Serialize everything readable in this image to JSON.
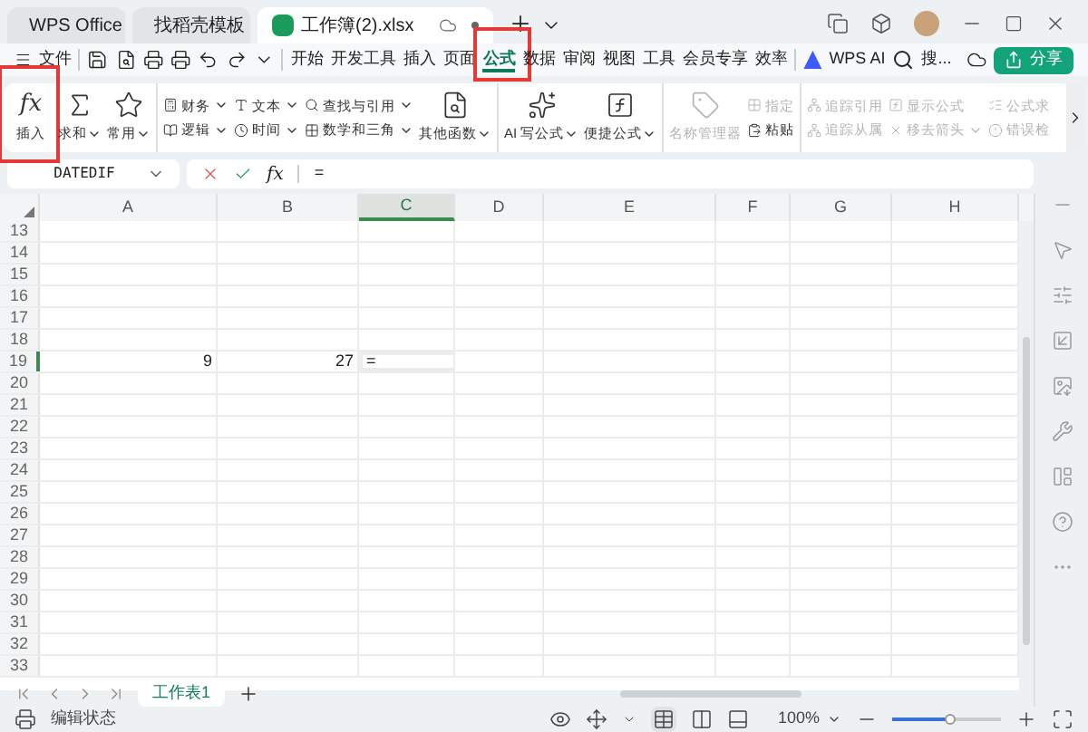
{
  "title_bar": {
    "tabs": [
      {
        "label": "WPS Office",
        "kind": "home",
        "selected": false
      },
      {
        "label": "找稻壳模板",
        "kind": "template",
        "selected": false
      },
      {
        "label": "工作簿(2).xlsx",
        "kind": "sheet",
        "selected": true
      }
    ]
  },
  "menu_bar": {
    "file": "文件",
    "items": [
      {
        "label": "开始",
        "selected": false,
        "highlighted": false
      },
      {
        "label": "开发工具",
        "selected": false,
        "highlighted": false
      },
      {
        "label": "插入",
        "selected": false,
        "highlighted": false
      },
      {
        "label": "页面",
        "selected": false,
        "highlighted": false
      },
      {
        "label": "公式",
        "selected": true,
        "highlighted": true
      },
      {
        "label": "数据",
        "selected": false,
        "highlighted": false
      },
      {
        "label": "审阅",
        "selected": false,
        "highlighted": false
      },
      {
        "label": "视图",
        "selected": false,
        "highlighted": false
      },
      {
        "label": "工具",
        "selected": false,
        "highlighted": false
      },
      {
        "label": "会员专享",
        "selected": false,
        "highlighted": false
      },
      {
        "label": "效率",
        "selected": false,
        "highlighted": false
      }
    ],
    "ai": "WPS AI",
    "search": "搜...",
    "share": "分享"
  },
  "ribbon": {
    "groups": [
      {
        "columns": [
          [
            {
              "label": "插入",
              "symbol": "fx",
              "caret": false,
              "disabled": false,
              "highlighted": true
            }
          ],
          [
            {
              "label": "求和",
              "caret": true,
              "disabled": false
            }
          ],
          [
            {
              "label": "常用",
              "caret": true,
              "disabled": false
            }
          ]
        ]
      },
      {
        "columns": [
          [
            {
              "label": "财务",
              "caret": true,
              "disabled": false
            },
            {
              "label": "逻辑",
              "caret": true,
              "disabled": false
            }
          ],
          [
            {
              "label": "文本",
              "caret": true,
              "disabled": false
            },
            {
              "label": "时间",
              "caret": true,
              "disabled": false
            }
          ],
          [
            {
              "label": "查找与引用",
              "caret": true,
              "disabled": false
            },
            {
              "label": "数学和三角",
              "caret": true,
              "disabled": false
            }
          ],
          [
            {
              "label": "其他函数",
              "caret": true,
              "disabled": false
            }
          ]
        ]
      },
      {
        "columns": [
          [
            {
              "label": "AI 写公式",
              "caret": true,
              "disabled": false
            }
          ],
          [
            {
              "label": "便捷公式",
              "caret": true,
              "disabled": false
            }
          ]
        ]
      },
      {
        "columns": [
          [
            {
              "label": "名称管理器",
              "caret": false,
              "disabled": true
            }
          ],
          [
            {
              "label": "指定",
              "caret": false,
              "disabled": true
            },
            {
              "label": "粘贴",
              "caret": false,
              "disabled": false
            }
          ]
        ]
      },
      {
        "columns": [
          [
            {
              "label": "追踪引用",
              "caret": false,
              "disabled": true
            },
            {
              "label": "追踪从属",
              "caret": false,
              "disabled": true
            }
          ],
          [
            {
              "label": "显示公式",
              "caret": false,
              "disabled": true
            },
            {
              "label": "移去箭头",
              "caret": true,
              "disabled": true
            }
          ],
          [
            {
              "label": "公式求",
              "caret": false,
              "disabled": true
            },
            {
              "label": "错误检",
              "caret": false,
              "disabled": true
            }
          ]
        ]
      }
    ]
  },
  "formula_bar": {
    "name_box": "DATEDIF",
    "function_symbol": "fx",
    "value": "="
  },
  "sheet": {
    "columns": [
      {
        "label": "A",
        "selected": false
      },
      {
        "label": "B",
        "selected": false
      },
      {
        "label": "C",
        "selected": true
      },
      {
        "label": "D",
        "selected": false
      },
      {
        "label": "E",
        "selected": false
      },
      {
        "label": "F",
        "selected": false
      },
      {
        "label": "G",
        "selected": false
      },
      {
        "label": "H",
        "selected": false
      }
    ],
    "rows": [
      {
        "number": "13",
        "selected": false
      },
      {
        "number": "14",
        "selected": false
      },
      {
        "number": "15",
        "selected": false
      },
      {
        "number": "16",
        "selected": false
      },
      {
        "number": "17",
        "selected": false
      },
      {
        "number": "18",
        "selected": false
      },
      {
        "number": "19",
        "selected": true,
        "cells": [
          "9",
          "27",
          "="
        ]
      },
      {
        "number": "20",
        "selected": false
      },
      {
        "number": "21",
        "selected": false
      },
      {
        "number": "22",
        "selected": false
      },
      {
        "number": "23",
        "selected": false
      },
      {
        "number": "24",
        "selected": false
      },
      {
        "number": "25",
        "selected": false
      },
      {
        "number": "26",
        "selected": false
      },
      {
        "number": "27",
        "selected": false
      },
      {
        "number": "28",
        "selected": false
      },
      {
        "number": "29",
        "selected": false
      },
      {
        "number": "30",
        "selected": false
      },
      {
        "number": "31",
        "selected": false
      },
      {
        "number": "32",
        "selected": false
      },
      {
        "number": "33",
        "selected": false
      }
    ]
  },
  "sheet_tabs": [
    {
      "label": "工作表1",
      "selected": true
    }
  ],
  "status_bar": {
    "mode": "编辑状态",
    "zoom": "100%",
    "zoom_slider": {
      "level": 0.53
    }
  }
}
